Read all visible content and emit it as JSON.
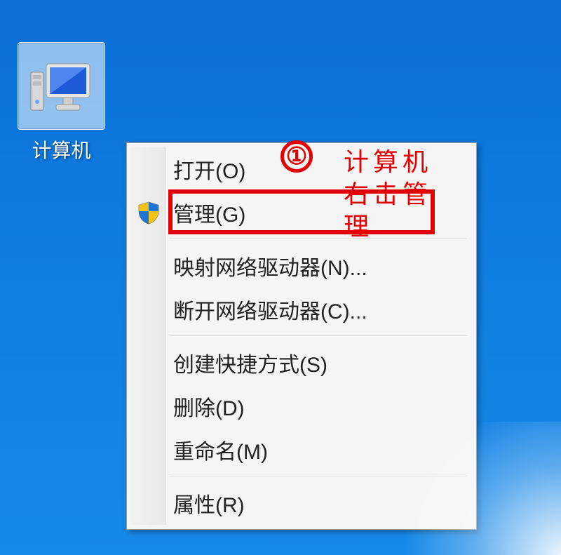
{
  "desktop": {
    "icon_label": "计算机",
    "icon_name": "computer-icon"
  },
  "context_menu": {
    "items": [
      {
        "label": "打开(O)",
        "has_shield": false
      },
      {
        "label": "管理(G)",
        "has_shield": true
      },
      {
        "label": "映射网络驱动器(N)...",
        "has_shield": false
      },
      {
        "label": "断开网络驱动器(C)...",
        "has_shield": false
      },
      {
        "label": "创建快捷方式(S)",
        "has_shield": false
      },
      {
        "label": "删除(D)",
        "has_shield": false
      },
      {
        "label": "重命名(M)",
        "has_shield": false
      },
      {
        "label": "属性(R)",
        "has_shield": false
      }
    ],
    "highlighted_index": 1
  },
  "annotations": {
    "circle_number": "①",
    "side_text_line1": "计算机",
    "side_text_line2": "右击管",
    "side_text_line3": "理"
  },
  "colors": {
    "highlight_red": "#e30000",
    "desktop_blue": "#0f7be0"
  }
}
